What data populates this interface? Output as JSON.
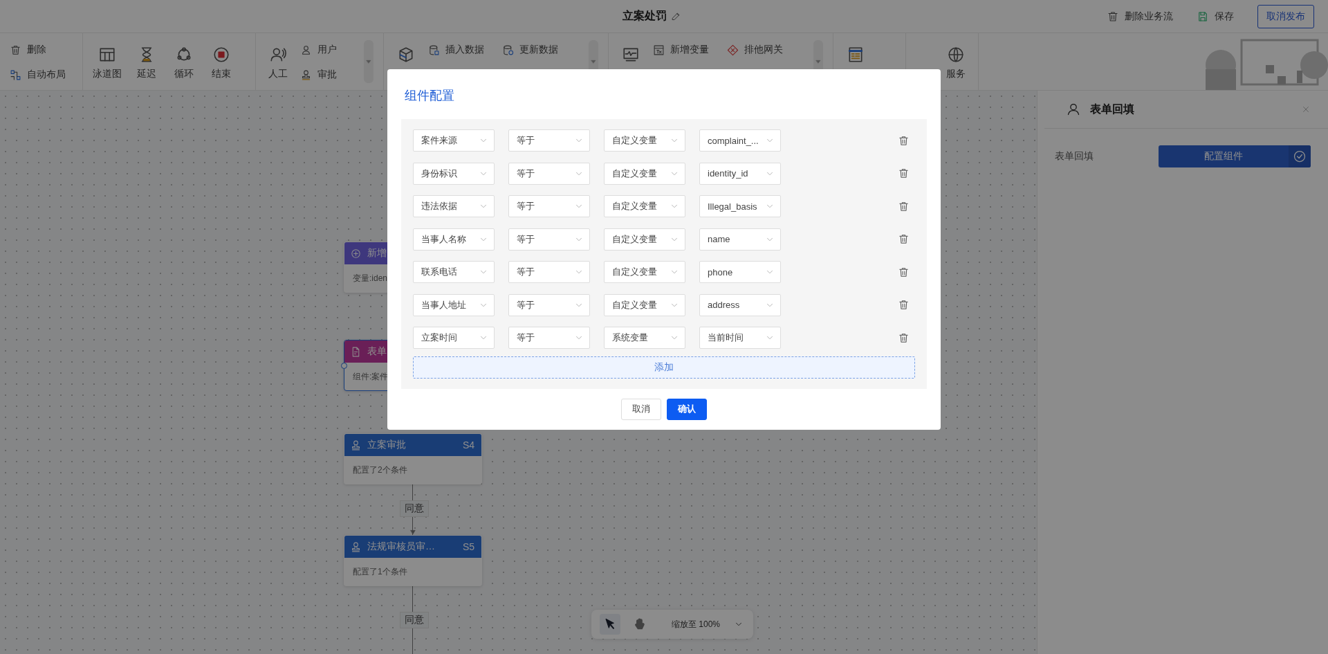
{
  "header": {
    "title": "立案处罚",
    "actions": [
      {
        "kind": "delete",
        "label": "删除业务流"
      },
      {
        "kind": "save",
        "label": "保存"
      },
      {
        "kind": "primary",
        "label": "取消发布"
      }
    ]
  },
  "toolbar": {
    "groups": [
      {
        "kind": "column",
        "items": [
          {
            "kind": "delete",
            "label": "删除"
          },
          {
            "kind": "layout",
            "label": "自动布局"
          }
        ]
      },
      {
        "kind": "column",
        "tiles": [
          {
            "kind": "lane",
            "label": "泳道图"
          },
          {
            "kind": "delay",
            "label": "延迟"
          },
          {
            "kind": "loop",
            "label": "循环"
          },
          {
            "kind": "end",
            "label": "结束"
          }
        ]
      },
      {
        "kind": "column",
        "dropdown": true,
        "tiles": [
          {
            "kind": "manual",
            "label": "人工"
          }
        ],
        "items": [
          {
            "kind": "user",
            "label": "用户"
          },
          {
            "kind": "approve",
            "label": "审批"
          }
        ]
      },
      {
        "kind": "grid",
        "dropdown": true,
        "tiles": [
          {
            "kind": "data"
          }
        ],
        "items": [
          {
            "kind": "insert",
            "label": "插入数据"
          },
          {
            "kind": "update",
            "label": "更新数据"
          }
        ]
      },
      {
        "kind": "grid",
        "dropdown": true,
        "tiles": [
          {
            "kind": "monitor"
          }
        ],
        "items": [
          {
            "kind": "variable",
            "label": "新增变量"
          },
          {
            "kind": "gateway",
            "label": "排他网关"
          }
        ]
      },
      {
        "kind": "column",
        "tiles": [
          {
            "kind": "form"
          }
        ]
      },
      {
        "kind": "column",
        "tiles": [
          {
            "kind": "service",
            "label": "服务"
          }
        ]
      }
    ]
  },
  "canvas": {
    "nodes": [
      {
        "kind": "variable",
        "title": "新增",
        "body": "变量:iden",
        "selected": false
      },
      {
        "kind": "form",
        "title": "表单",
        "body": "组件:案件",
        "selected": true
      },
      {
        "kind": "approve",
        "title": "立案审批",
        "code": "S4",
        "body": "配置了2个条件",
        "selected": false
      },
      {
        "kind": "approve",
        "title": "法规审核员审…",
        "code": "S5",
        "body": "配置了1个条件",
        "selected": false
      }
    ],
    "edges": [
      {
        "label": "同意"
      },
      {
        "label": "同意"
      }
    ]
  },
  "zoom_bar": {
    "tools": [
      {
        "kind": "pointer",
        "selected": true
      },
      {
        "kind": "hand",
        "selected": false
      }
    ],
    "zoom": "缩放至 100%"
  },
  "side_panel": {
    "title": "表单回填",
    "field": {
      "label": "表单回填",
      "button": "配置组件",
      "configured": true
    }
  },
  "dialog": {
    "title": "组件配置",
    "rows": [
      {
        "field": "案件来源",
        "operator": "等于",
        "source": "自定义变量",
        "value": "complaint_..."
      },
      {
        "field": "身份标识",
        "operator": "等于",
        "source": "自定义变量",
        "value": "identity_id"
      },
      {
        "field": "违法依据",
        "operator": "等于",
        "source": "自定义变量",
        "value": "Illegal_basis"
      },
      {
        "field": "当事人名称",
        "operator": "等于",
        "source": "自定义变量",
        "value": "name"
      },
      {
        "field": "联系电话",
        "operator": "等于",
        "source": "自定义变量",
        "value": "phone"
      },
      {
        "field": "当事人地址",
        "operator": "等于",
        "source": "自定义变量",
        "value": "address"
      },
      {
        "field": "立案时间",
        "operator": "等于",
        "source": "系统变量",
        "value": "当前时间"
      }
    ],
    "add": "添加",
    "buttons": [
      {
        "kind": "default",
        "label": "取消"
      },
      {
        "kind": "primary",
        "label": "确认"
      }
    ]
  }
}
